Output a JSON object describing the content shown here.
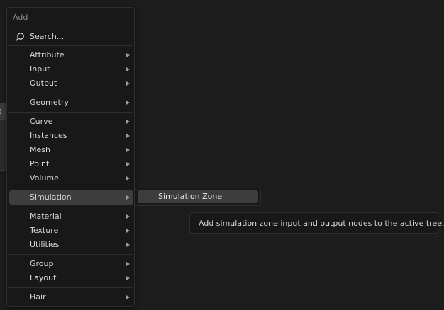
{
  "menu": {
    "title": "Add",
    "search_label": "Search...",
    "items": [
      {
        "label": "Attribute",
        "has_submenu": true
      },
      {
        "label": "Input",
        "has_submenu": true
      },
      {
        "label": "Output",
        "has_submenu": true
      },
      {
        "label": "Geometry",
        "has_submenu": true
      },
      {
        "label": "Curve",
        "has_submenu": true
      },
      {
        "label": "Instances",
        "has_submenu": true
      },
      {
        "label": "Mesh",
        "has_submenu": true
      },
      {
        "label": "Point",
        "has_submenu": true
      },
      {
        "label": "Volume",
        "has_submenu": true
      },
      {
        "label": "Simulation",
        "has_submenu": true,
        "active": true
      },
      {
        "label": "Material",
        "has_submenu": true
      },
      {
        "label": "Texture",
        "has_submenu": true
      },
      {
        "label": "Utilities",
        "has_submenu": true
      },
      {
        "label": "Group",
        "has_submenu": true
      },
      {
        "label": "Layout",
        "has_submenu": true
      },
      {
        "label": "Hair",
        "has_submenu": true
      }
    ]
  },
  "submenu": {
    "items": [
      {
        "label": "Simulation Zone"
      }
    ]
  },
  "tooltip": {
    "text": "Add simulation zone input and output nodes to the active tree."
  },
  "background_node": {
    "partial_text": "p"
  },
  "colors": {
    "menu_bg": "#181818",
    "highlight": "#3d3d3d",
    "canvas_bg": "#1c1c1c",
    "text": "#d9d9d9"
  }
}
